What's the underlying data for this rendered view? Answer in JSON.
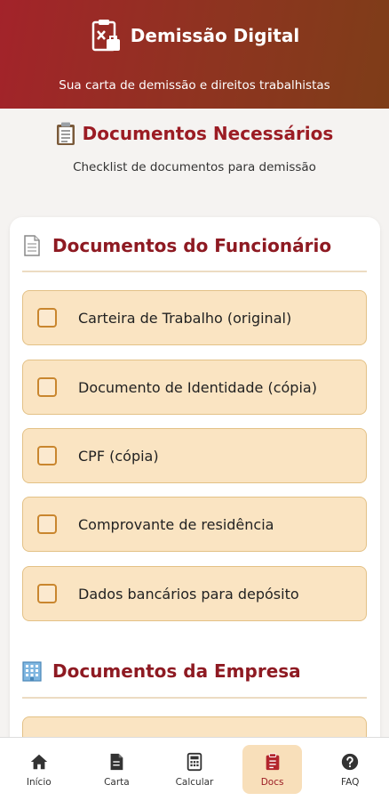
{
  "header": {
    "title": "Demissão Digital",
    "subtitle": "Sua carta de demissão e direitos trabalhistas",
    "gradient": [
      "#a3232a",
      "#7e3d18"
    ]
  },
  "page": {
    "title": "Documentos Necessários",
    "subtitle": "Checklist de documentos para demissão"
  },
  "sections": [
    {
      "title": "Documentos do Funcionário",
      "icon": "document-icon",
      "items": [
        {
          "label": "Carteira de Trabalho (original)",
          "checked": false
        },
        {
          "label": "Documento de Identidade (cópia)",
          "checked": false
        },
        {
          "label": "CPF (cópia)",
          "checked": false
        },
        {
          "label": "Comprovante de residência",
          "checked": false
        },
        {
          "label": "Dados bancários para depósito",
          "checked": false
        }
      ]
    },
    {
      "title": "Documentos da Empresa",
      "icon": "building-icon",
      "items": []
    }
  ],
  "nav": [
    {
      "label": "Início",
      "icon": "home-icon",
      "active": false
    },
    {
      "label": "Carta",
      "icon": "file-icon",
      "active": false
    },
    {
      "label": "Calcular",
      "icon": "calculator-icon",
      "active": false
    },
    {
      "label": "Docs",
      "icon": "clipboard-icon",
      "active": true
    },
    {
      "label": "FAQ",
      "icon": "question-icon",
      "active": false
    }
  ],
  "colors": {
    "accent": "#9b1c24",
    "item_bg": "#fae4c2",
    "checkbox": "#c9862e"
  }
}
